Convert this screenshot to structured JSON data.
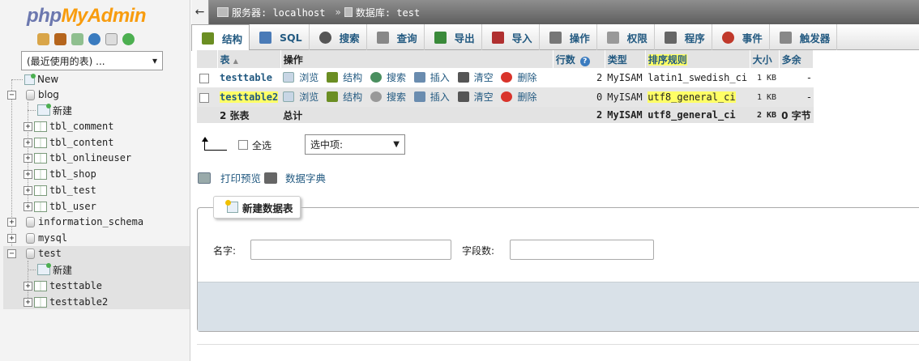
{
  "nav": {
    "logo_part1": "php",
    "logo_part2": "MyAdmin",
    "icons": [
      "home-icon",
      "exit-icon",
      "query-window-icon",
      "help-icon",
      "docs-icon",
      "reload-icon"
    ],
    "recent_tables": "(最近使用的表) ...",
    "tree": {
      "new": "New",
      "blog": "blog",
      "blog_new": "新建",
      "blog_tables": [
        "tbl_comment",
        "tbl_content",
        "tbl_onlineuser",
        "tbl_shop",
        "tbl_test",
        "tbl_user"
      ],
      "information_schema": "information_schema",
      "mysql": "mysql",
      "test": "test",
      "test_new": "新建",
      "test_tables": [
        "testtable",
        "testtable2"
      ]
    }
  },
  "breadcrumb": {
    "server": "服务器: localhost",
    "sep": "»",
    "database": "数据库: test"
  },
  "tabs": [
    {
      "label": "结构",
      "icon": "structure-icon",
      "color": "#6b8e23"
    },
    {
      "label": "SQL",
      "icon": "sql-icon",
      "color": "#4a7bb7"
    },
    {
      "label": "搜索",
      "icon": "search-icon",
      "color": "#555555"
    },
    {
      "label": "查询",
      "icon": "query-icon",
      "color": "#888888"
    },
    {
      "label": "导出",
      "icon": "export-icon",
      "color": "#3a8a3a"
    },
    {
      "label": "导入",
      "icon": "import-icon",
      "color": "#b03030"
    },
    {
      "label": "操作",
      "icon": "wrench-icon",
      "color": "#777777"
    },
    {
      "label": "权限",
      "icon": "privileges-icon",
      "color": "#999999"
    },
    {
      "label": "程序",
      "icon": "routines-icon",
      "color": "#666666"
    },
    {
      "label": "事件",
      "icon": "events-icon",
      "color": "#c0392b"
    },
    {
      "label": "触发器",
      "icon": "triggers-icon",
      "color": "#888888"
    }
  ],
  "table": {
    "headers": {
      "table": "表",
      "sort_arrow": "▲",
      "action": "操作",
      "rows": "行数",
      "help": "?",
      "type": "类型",
      "collation": "排序规则",
      "size": "大小",
      "overhead": "多余"
    },
    "actions": {
      "browse": "浏览",
      "structure": "结构",
      "search": "搜索",
      "insert": "插入",
      "empty": "清空",
      "drop": "删除"
    },
    "rows": [
      {
        "name": "testtable",
        "rows": "2",
        "type": "MyISAM",
        "collation": "latin1_swedish_ci",
        "size": "1 KB",
        "overhead": "-"
      },
      {
        "name": "testtable2",
        "rows": "0",
        "type": "MyISAM",
        "collation": "utf8_general_ci",
        "size": "1 KB",
        "overhead": "-"
      }
    ],
    "summary": {
      "count": "2 张表",
      "label": "总计",
      "rows": "2",
      "type": "MyISAM",
      "collation": "utf8_general_ci",
      "size": "2 KB",
      "overhead": "0 字节"
    }
  },
  "bulk": {
    "check_all": "全选",
    "with_selected": "选中项:"
  },
  "links": {
    "print_view": "打印预览",
    "data_dictionary": "数据字典"
  },
  "create_table": {
    "legend": "新建数据表",
    "name_label": "名字:",
    "columns_label": "字段数:",
    "name_value": "",
    "columns_value": ""
  },
  "colors": {
    "link": "#235a81",
    "highlight": "#ffff66",
    "logo_php": "#6c78af",
    "logo_myadmin": "#f89c0e"
  }
}
